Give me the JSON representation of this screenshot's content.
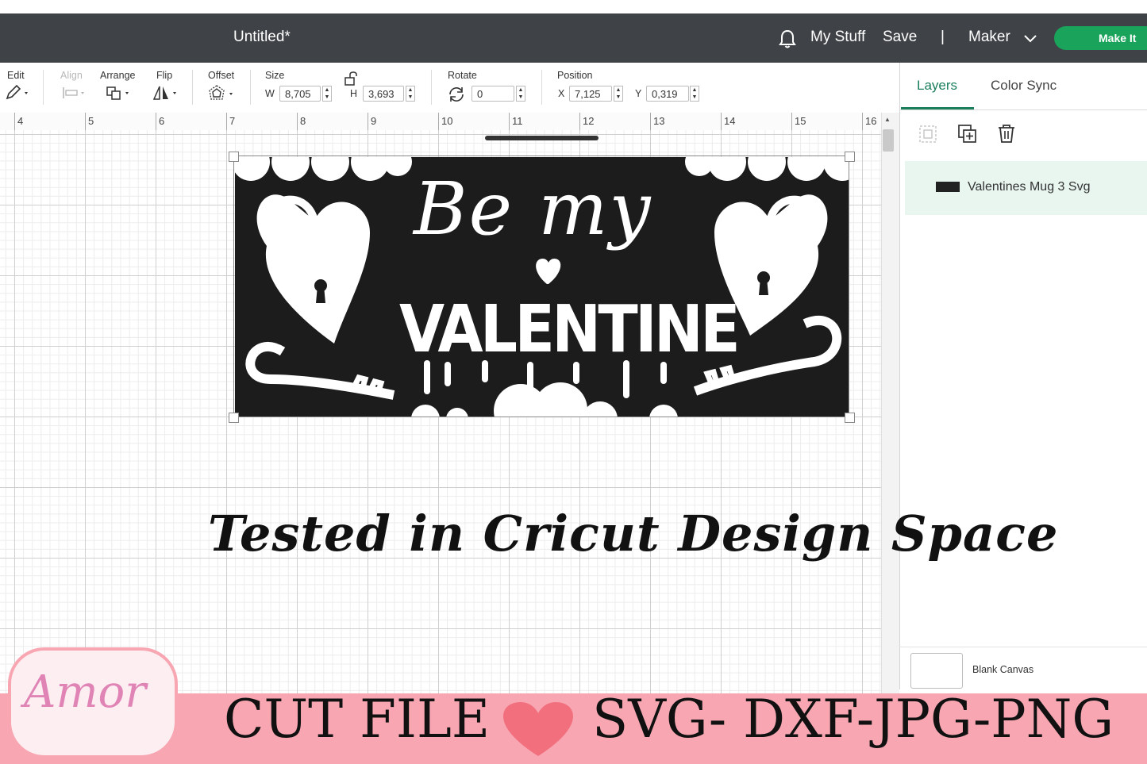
{
  "header": {
    "title": "Untitled*",
    "my_stuff": "My Stuff",
    "save": "Save",
    "separator": "|",
    "machine": "Maker",
    "make_it": "Make It",
    "make_it_color": "#1aa35a"
  },
  "toolbar": {
    "edit": "Edit",
    "align": "Align",
    "arrange": "Arrange",
    "flip": "Flip",
    "offset": "Offset",
    "size": "Size",
    "w_label": "W",
    "w_value": "8,705",
    "h_label": "H",
    "h_value": "3,693",
    "rotate": "Rotate",
    "rotate_value": "0",
    "position": "Position",
    "x_label": "X",
    "x_value": "7,125",
    "y_label": "Y",
    "y_value": "0,319"
  },
  "ruler": {
    "ticks": [
      "4",
      "5",
      "6",
      "7",
      "8",
      "9",
      "10",
      "11",
      "12",
      "13",
      "14",
      "15",
      "16"
    ]
  },
  "panel": {
    "tab_layers": "Layers",
    "tab_colorsync": "Color Sync",
    "layer_name": "Valentines Mug 3 Svg",
    "blank_canvas": "Blank Canvas",
    "accent": "#1a7f5a"
  },
  "design": {
    "line1": "Be my",
    "line2": "VALENTINE"
  },
  "overlay": {
    "tested": "Tested in Cricut Design Space"
  },
  "banner": {
    "left": "CUT FILE",
    "right": "SVG- DXF-JPG-PNG",
    "logo": "Amor",
    "color": "#f7a6b2"
  }
}
